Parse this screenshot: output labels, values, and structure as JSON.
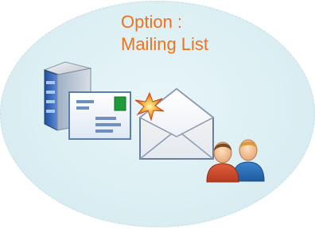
{
  "title": {
    "line1": "Option :",
    "line2": "Mailing List"
  },
  "icons": {
    "server": "server-icon",
    "letter": "letter-icon",
    "envelope": "open-envelope-icon",
    "spark": "new-spark-icon",
    "users": "users-icon"
  },
  "colors": {
    "title": "#f0711d",
    "background": "#dceff3"
  }
}
